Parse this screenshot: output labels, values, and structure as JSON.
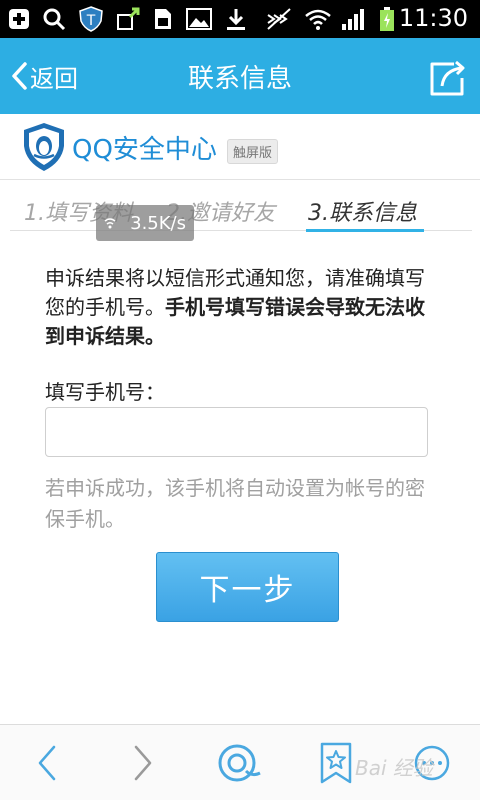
{
  "statusbar": {
    "time": "11:30",
    "icons": [
      "add-icon",
      "search-icon",
      "shield-t-icon",
      "upload-icon",
      "sim-icon",
      "image-icon",
      "download-icon",
      "mute-icon",
      "wifi-icon",
      "signal-icon",
      "battery-icon"
    ]
  },
  "titlebar": {
    "back_label": "返回",
    "title": "联系信息",
    "share_icon": "share-icon",
    "bg_color": "#2daee3"
  },
  "brand": {
    "name": "QQ安全中心",
    "badge": "触屏版"
  },
  "steps": [
    {
      "label": "1.填写资料",
      "active": false
    },
    {
      "label": "2.邀请好友",
      "active": false
    },
    {
      "label": "3.联系信息",
      "active": true
    }
  ],
  "speed_overlay": "3.5K/s",
  "content": {
    "desc_normal": "申诉结果将以短信形式通知您，请准确填写您的手机号。",
    "desc_bold": "手机号填写错误会导致无法收到申诉结果。",
    "field_label": "填写手机号：",
    "phone_value": "",
    "phone_placeholder": "",
    "hint": "若申诉成功，该手机将自动设置为帐号的密保手机。",
    "next_button": "下一步"
  },
  "bottom_nav": [
    "back-icon",
    "forward-icon",
    "qq-browser-icon",
    "bookmark-icon",
    "more-icon"
  ],
  "watermark": "Bai 经验"
}
